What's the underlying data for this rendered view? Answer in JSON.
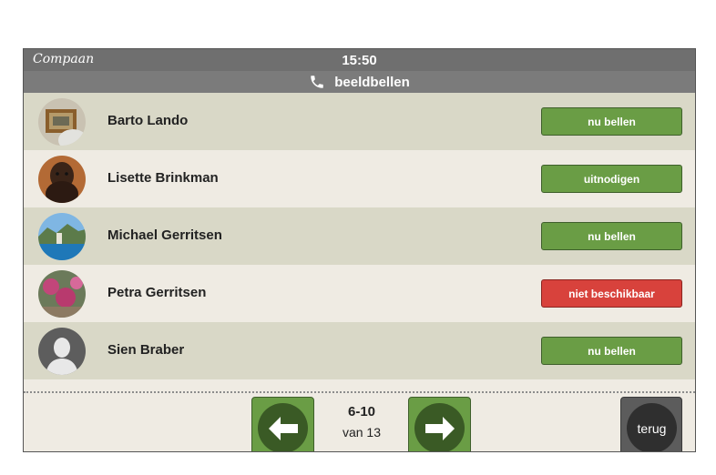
{
  "status_bar": {
    "brand": "Compaan",
    "time": "15:50"
  },
  "title_bar": {
    "icon": "phone-icon",
    "title": "beeldbellen"
  },
  "contacts": [
    {
      "name": "Barto Lando",
      "action": "nu bellen",
      "action_color": "#6a9d45",
      "avatar": "photo-painting"
    },
    {
      "name": "Lisette Brinkman",
      "action": "uitnodigen",
      "action_color": "#6a9d45",
      "avatar": "photo-dog"
    },
    {
      "name": "Michael Gerritsen",
      "action": "nu bellen",
      "action_color": "#6a9d45",
      "avatar": "photo-coast"
    },
    {
      "name": "Petra Gerritsen",
      "action": "niet beschikbaar",
      "action_color": "#d8423c",
      "avatar": "photo-flowers"
    },
    {
      "name": "Sien Braber",
      "action": "nu bellen",
      "action_color": "#6a9d45",
      "avatar": "default-person-icon"
    }
  ],
  "pagination": {
    "range": "6-10",
    "total": "van 13",
    "prev_icon": "arrow-left-icon",
    "next_icon": "arrow-right-icon"
  },
  "back_button": {
    "label": "terug"
  },
  "colors": {
    "green": "#6a9d45",
    "dark_green": "#3a5a25",
    "red": "#d8423c",
    "row_odd": "#d9d8c7",
    "row_even": "#efebe3"
  }
}
